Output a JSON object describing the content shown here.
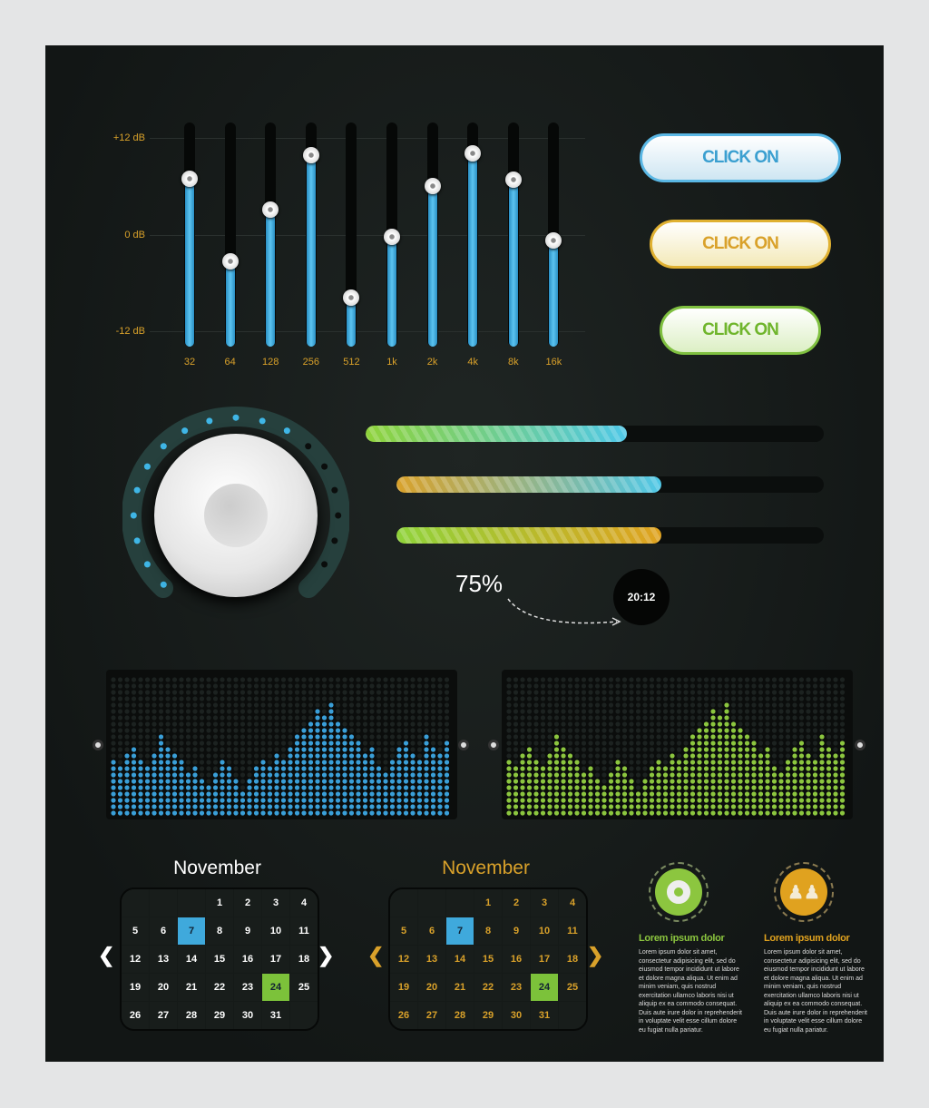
{
  "equalizer": {
    "scale_labels": [
      "+12 dB",
      "0 dB",
      "-12 dB"
    ],
    "range_db": [
      -12,
      12
    ],
    "bands": [
      {
        "freq": "32",
        "gain_db": 7
      },
      {
        "freq": "64",
        "gain_db": -3.3
      },
      {
        "freq": "128",
        "gain_db": 3.1
      },
      {
        "freq": "256",
        "gain_db": 9.9
      },
      {
        "freq": "512",
        "gain_db": -7.8
      },
      {
        "freq": "1k",
        "gain_db": -0.2
      },
      {
        "freq": "2k",
        "gain_db": 6.1
      },
      {
        "freq": "4k",
        "gain_db": 10.1
      },
      {
        "freq": "8k",
        "gain_db": 6.9
      },
      {
        "freq": "16k",
        "gain_db": -0.7
      }
    ]
  },
  "buttons": [
    {
      "label": "CLICK ON",
      "color": "#3a9fd0"
    },
    {
      "label": "CLICK ON",
      "color": "#d9a12a"
    },
    {
      "label": "CLICK ON",
      "color": "#6fb52c"
    }
  ],
  "progress": [
    {
      "percent": 57,
      "gradient": [
        "#8fd33a",
        "#4fc8e8"
      ]
    },
    {
      "percent": 62,
      "gradient": [
        "#d9a12a",
        "#4fc8e8"
      ]
    },
    {
      "percent": 62,
      "gradient": [
        "#8fd33a",
        "#e0a21f"
      ]
    }
  ],
  "volume_label": "75%",
  "time_bubble": "20:12",
  "visualizers": [
    {
      "color": "#3a9fd8",
      "levels": [
        9,
        8,
        10,
        11,
        9,
        8,
        10,
        13,
        11,
        10,
        9,
        7,
        8,
        6,
        5,
        7,
        9,
        8,
        6,
        4,
        6,
        8,
        9,
        8,
        10,
        9,
        11,
        13,
        14,
        15,
        17,
        16,
        18,
        15,
        14,
        13,
        12,
        10,
        11,
        8,
        7,
        9,
        11,
        12,
        10,
        9,
        13,
        11,
        10,
        12
      ]
    },
    {
      "color": "#8cc63f",
      "levels": [
        9,
        8,
        10,
        11,
        9,
        8,
        10,
        13,
        11,
        10,
        9,
        7,
        8,
        6,
        5,
        7,
        9,
        8,
        6,
        4,
        6,
        8,
        9,
        8,
        10,
        9,
        11,
        13,
        14,
        15,
        17,
        16,
        18,
        15,
        14,
        13,
        12,
        10,
        11,
        8,
        7,
        9,
        11,
        12,
        10,
        9,
        13,
        11,
        10,
        12
      ]
    }
  ],
  "calendars": [
    {
      "month": "November",
      "color": "#ffffff",
      "days": [
        "",
        "",
        "",
        "1",
        "2",
        "3",
        "4",
        "5",
        "6",
        "7",
        "8",
        "9",
        "10",
        "11",
        "12",
        "13",
        "14",
        "15",
        "16",
        "17",
        "18",
        "19",
        "20",
        "21",
        "22",
        "23",
        "24",
        "25",
        "26",
        "27",
        "28",
        "29",
        "30",
        "31",
        ""
      ],
      "highlight_blue": "7",
      "highlight_green": "24"
    },
    {
      "month": "November",
      "color": "#d9a12a",
      "days": [
        "",
        "",
        "",
        "1",
        "2",
        "3",
        "4",
        "5",
        "6",
        "7",
        "8",
        "9",
        "10",
        "11",
        "12",
        "13",
        "14",
        "15",
        "16",
        "17",
        "18",
        "19",
        "20",
        "21",
        "22",
        "23",
        "24",
        "25",
        "26",
        "27",
        "28",
        "29",
        "30",
        "31",
        ""
      ],
      "highlight_blue": "7",
      "highlight_green": "24"
    }
  ],
  "info": [
    {
      "icon": "target-icon",
      "color": "#8cc63f",
      "title": "Lorem ipsum dolor",
      "text": "Lorem ipsum dolor sit amet, consectetur adipisicing elit, sed do eiusmod tempor incididunt ut labore et dolore magna aliqua. Ut enim ad minim veniam, quis nostrud exercitation ullamco laboris nisi ut aliquip ex ea commodo consequat. Duis aute irure dolor in reprehenderit in voluptate velit esse cillum dolore eu fugiat nulla pariatur."
    },
    {
      "icon": "people-icon",
      "color": "#e0a21f",
      "title": "Lorem ipsum dolor",
      "text": "Lorem ipsum dolor sit amet, consectetur adipisicing elit, sed do eiusmod tempor incididunt ut labore et dolore magna aliqua. Ut enim ad minim veniam, quis nostrud exercitation ullamco laboris nisi ut aliquip ex ea commodo consequat. Duis aute irure dolor in reprehenderit in voluptate velit esse cillum dolore eu fugiat nulla pariatur."
    }
  ]
}
